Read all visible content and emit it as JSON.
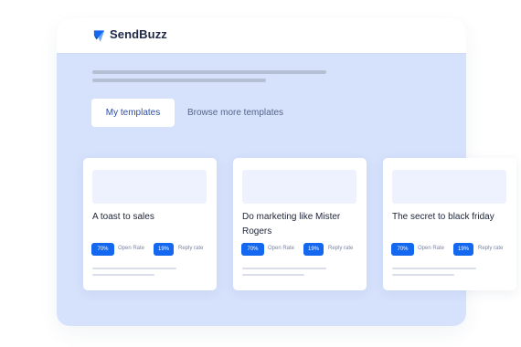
{
  "app": {
    "name": "SendBuzz",
    "logo_icon": "sendbuzz-logo-icon"
  },
  "colors": {
    "page_background": "#ffffff",
    "panel_background": "#d6e2fc",
    "accent": "#1467ef",
    "tab_text": "#2b4ea8"
  },
  "tabs": {
    "active_label": "My templates",
    "browse_label": "Browse more templates"
  },
  "templates": [
    {
      "title": "A toast to sales",
      "open_rate": "70%",
      "open_rate_label": "Open Rate",
      "reply_rate": "19%",
      "reply_rate_label": "Reply rate"
    },
    {
      "title": "Do marketing like Mister Rogers",
      "open_rate": "70%",
      "open_rate_label": "Open Rate",
      "reply_rate": "19%",
      "reply_rate_label": "Reply rate"
    },
    {
      "title": "The secret to black friday",
      "open_rate": "70%",
      "open_rate_label": "Open Rate",
      "reply_rate": "19%",
      "reply_rate_label": "Reply rate"
    }
  ]
}
